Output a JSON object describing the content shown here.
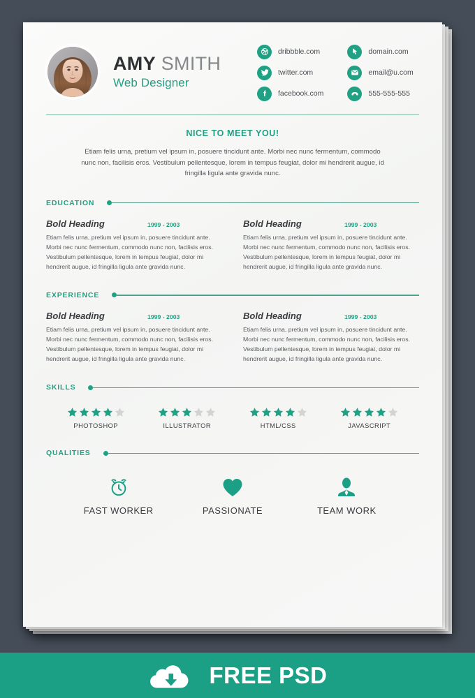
{
  "background_color": "#454d58",
  "accent_color": "#20a184",
  "header": {
    "avatar": "portrait-photo",
    "name_first": "AMY",
    "name_last": "SMITH",
    "job_title": "Web Designer"
  },
  "contacts": {
    "left": [
      {
        "icon": "dribbble-icon",
        "text": "dribbble.com"
      },
      {
        "icon": "twitter-icon",
        "text": "twitter.com"
      },
      {
        "icon": "facebook-icon",
        "text": "facebook.com"
      }
    ],
    "right": [
      {
        "icon": "cursor-icon",
        "text": "domain.com"
      },
      {
        "icon": "envelope-icon",
        "text": "email@u.com"
      },
      {
        "icon": "phone-icon",
        "text": "555-555-555"
      }
    ]
  },
  "intro": {
    "title": "NICE TO MEET YOU!",
    "text": "Etiam felis urna, pretium vel ipsum in, posuere tincidunt ante. Morbi nec nunc fermentum, commodo nunc non, facilisis eros. Vestibulum pellentesque, lorem in tempus feugiat, dolor mi hendrerit augue, id fringilla ligula ante gravida nunc."
  },
  "sections": {
    "education": {
      "title": "EDUCATION",
      "entries": [
        {
          "heading": "Bold Heading",
          "date": "1999 - 2003",
          "body": "Etiam felis urna, pretium vel ipsum in, posuere tincidunt ante. Morbi nec nunc fermentum, commodo nunc non, facilisis eros. Vestibulum pellentesque, lorem in tempus feugiat, dolor mi hendrerit augue, id fringilla ligula ante gravida nunc."
        },
        {
          "heading": "Bold Heading",
          "date": "1999 - 2003",
          "body": "Etiam felis urna, pretium vel ipsum in, posuere tincidunt ante. Morbi nec nunc fermentum, commodo nunc non, facilisis eros. Vestibulum pellentesque, lorem in tempus feugiat, dolor mi hendrerit augue, id fringilla ligula ante gravida nunc."
        }
      ]
    },
    "experience": {
      "title": "EXPERIENCE",
      "entries": [
        {
          "heading": "Bold Heading",
          "date": "1999 - 2003",
          "body": "Etiam felis urna, pretium vel ipsum in, posuere tincidunt ante. Morbi nec nunc fermentum, commodo nunc non, facilisis eros. Vestibulum pellentesque, lorem in tempus feugiat, dolor mi hendrerit augue, id fringilla ligula ante gravida nunc."
        },
        {
          "heading": "Bold Heading",
          "date": "1999 - 2003",
          "body": "Etiam felis urna, pretium vel ipsum in, posuere tincidunt ante. Morbi nec nunc fermentum, commodo nunc non, facilisis eros. Vestibulum pellentesque, lorem in tempus feugiat, dolor mi hendrerit augue, id fringilla ligula ante gravida nunc."
        }
      ]
    },
    "skills": {
      "title": "SKILLS",
      "max_stars": 5,
      "items": [
        {
          "label": "PHOTOSHOP",
          "rating": 4
        },
        {
          "label": "ILLUSTRATOR",
          "rating": 3
        },
        {
          "label": "HTML/CSS",
          "rating": 4
        },
        {
          "label": "JAVASCRIPT",
          "rating": 4
        }
      ]
    },
    "qualities": {
      "title": "QUALITIES",
      "items": [
        {
          "icon": "alarm-clock-icon",
          "label": "FAST WORKER"
        },
        {
          "icon": "heart-icon",
          "label": "PASSIONATE"
        },
        {
          "icon": "person-icon",
          "label": "TEAM WORK"
        }
      ]
    }
  },
  "banner": {
    "icon": "cloud-download-icon",
    "text": "FREE PSD",
    "color": "#1ca085"
  }
}
